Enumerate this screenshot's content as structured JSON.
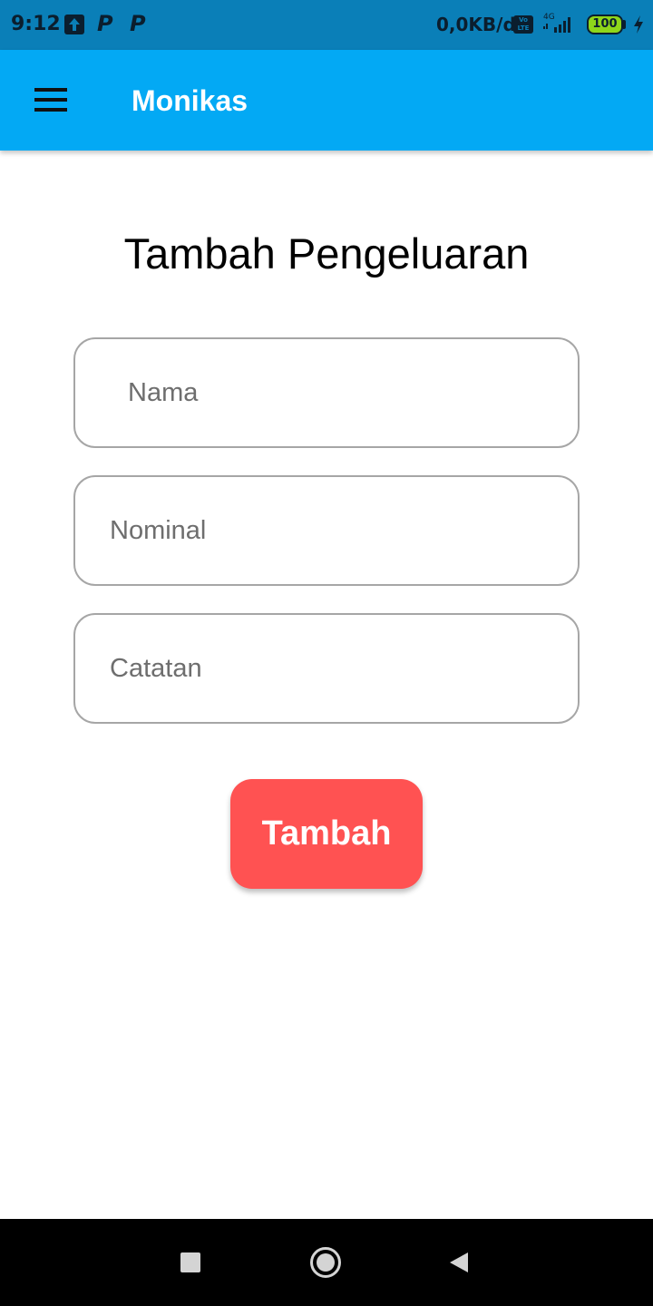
{
  "status_bar": {
    "time": "9:12",
    "notification_icons": [
      "upload-icon",
      "p-icon",
      "p-icon"
    ],
    "p_glyph": "P",
    "data_speed": "0,0KB/d",
    "volte_label_top": "Vo",
    "volte_label_bottom": "LTE",
    "network_type": "4G",
    "battery_level": "100",
    "charging": true,
    "background_color": "#0a7fb8"
  },
  "app_bar": {
    "title": "Monikas",
    "menu_icon": "hamburger-menu-icon",
    "background_color": "#03a9f4"
  },
  "form": {
    "heading": "Tambah Pengeluaran",
    "fields": {
      "nama": {
        "placeholder": "Nama",
        "value": ""
      },
      "nominal": {
        "placeholder": "Nominal",
        "value": ""
      },
      "catatan": {
        "placeholder": "Catatan",
        "value": ""
      }
    },
    "submit_label": "Tambah",
    "submit_color": "#ff5252"
  },
  "nav_bar": {
    "buttons": [
      "recent-apps-icon",
      "home-icon",
      "back-icon"
    ]
  }
}
